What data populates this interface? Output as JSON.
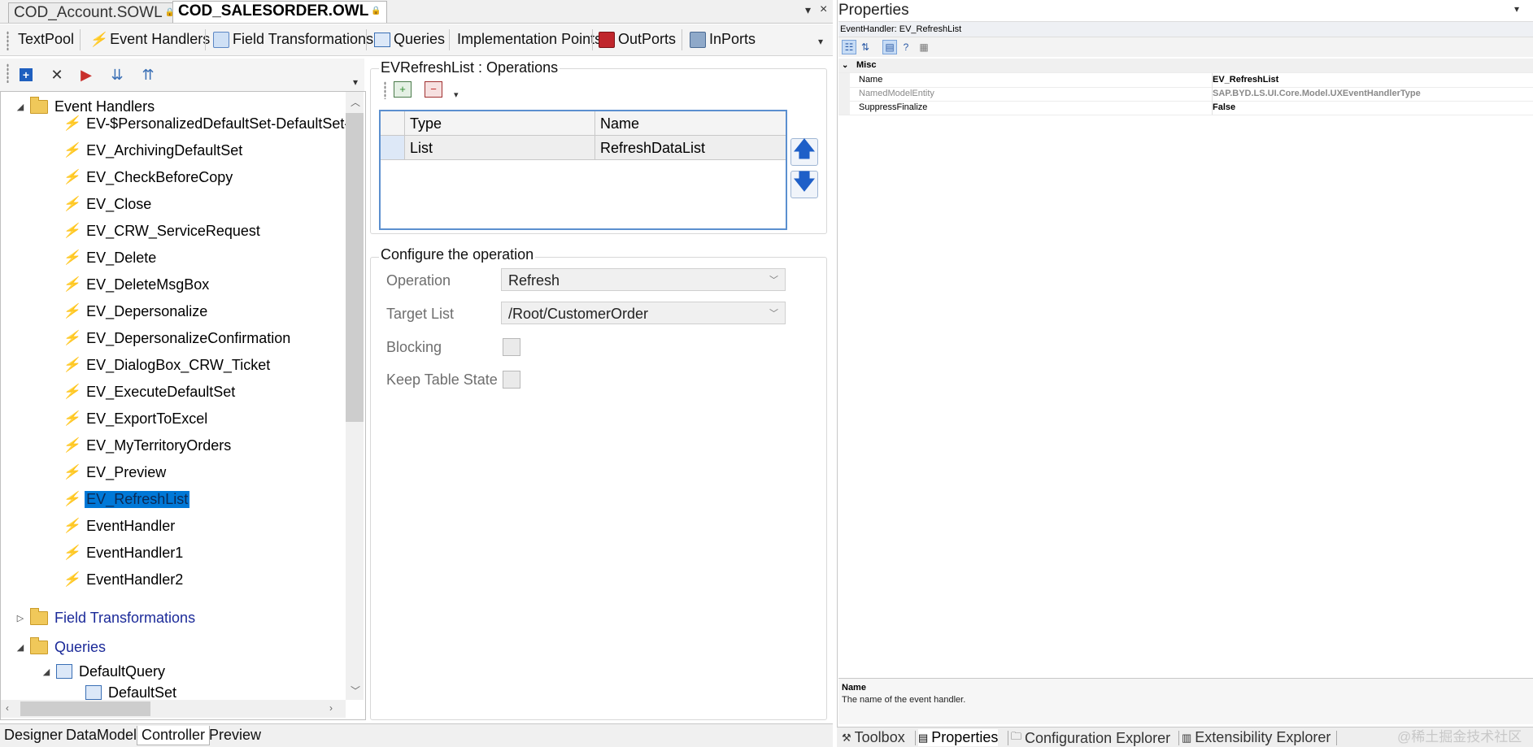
{
  "document_tabs": [
    {
      "label": "COD_Account.SOWL",
      "active": false
    },
    {
      "label": "COD_SALESORDER.OWL",
      "active": true
    }
  ],
  "main_toolbar": {
    "items": [
      "TextPool",
      "Event Handlers",
      "Field Transformations",
      "Queries",
      "Implementation Points",
      "OutPorts",
      "InPorts"
    ]
  },
  "tree": {
    "root_label": "Event Handlers",
    "event_handlers": [
      "EV-$PersonalizedDefaultSet-DefaultSet-",
      "EV_ArchivingDefaultSet",
      "EV_CheckBeforeCopy",
      "EV_Close",
      "EV_CRW_ServiceRequest",
      "EV_Delete",
      "EV_DeleteMsgBox",
      "EV_Depersonalize",
      "EV_DepersonalizeConfirmation",
      "EV_DialogBox_CRW_Ticket",
      "EV_ExecuteDefaultSet",
      "EV_ExportToExcel",
      "EV_MyTerritoryOrders",
      "EV_Preview",
      "EV_RefreshList",
      "EventHandler",
      "EventHandler1",
      "EventHandler2"
    ],
    "selected": "EV_RefreshList",
    "field_transformations_label": "Field Transformations",
    "queries_label": "Queries",
    "default_query_label": "DefaultQuery",
    "default_set_label": "DefaultSet"
  },
  "operations": {
    "legend": "EVRefreshList : Operations",
    "columns": [
      "Type",
      "Name"
    ],
    "rows": [
      {
        "type": "List",
        "name": "RefreshDataList"
      }
    ]
  },
  "configure": {
    "title": "Configure the operation",
    "operation_label": "Operation",
    "operation_value": "Refresh",
    "target_list_label": "Target List",
    "target_list_value": "/Root/CustomerOrder",
    "blocking_label": "Blocking",
    "keep_table_state_label": "Keep Table State"
  },
  "bottom_tabs": [
    "Designer",
    "DataModel",
    "Controller",
    "Preview"
  ],
  "bottom_tab_active": "Controller",
  "properties": {
    "title": "Properties",
    "object_label": "EventHandler: EV_RefreshList",
    "category": "Misc",
    "rows": [
      {
        "name": "Name",
        "value": "EV_RefreshList",
        "readonly": false
      },
      {
        "name": "NamedModelEntity",
        "value": "SAP.BYD.LS.UI.Core.Model.UXEventHandlerType",
        "readonly": true
      },
      {
        "name": "SuppressFinalize",
        "value": "False",
        "readonly": false
      }
    ],
    "description_title": "Name",
    "description_text": "The name of the event handler."
  },
  "side_tabs": [
    "Toolbox",
    "Properties",
    "Configuration Explorer",
    "Extensibility Explorer"
  ],
  "side_tab_active": "Properties",
  "watermark": "@稀土掘金技术社区",
  "colors": {
    "selection": "#0078d7",
    "accent_blue": "#1e5fc8",
    "folder": "#f0c85a",
    "bolt": "#d98b00"
  }
}
